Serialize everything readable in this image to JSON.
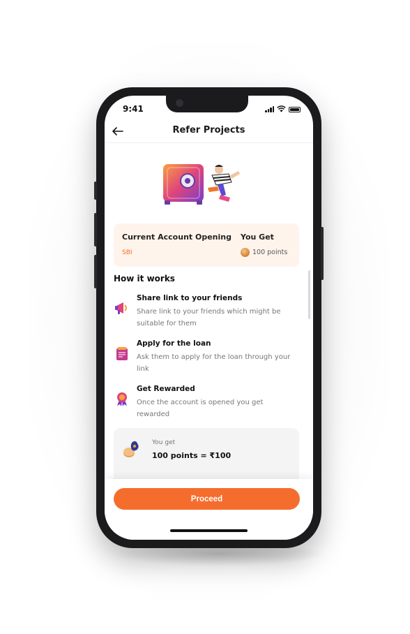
{
  "status_bar": {
    "time": "9:41"
  },
  "header": {
    "title": "Refer Projects",
    "back_icon": "arrow-left-icon"
  },
  "offer": {
    "name": "Current Account Opening",
    "bank": "SBI",
    "get_label": "You Get",
    "points": "100 points"
  },
  "how_it_works": {
    "title": "How it works",
    "steps": [
      {
        "icon": "megaphone-icon",
        "title": "Share link to your friends",
        "description": "Share link to your friends which might be suitable for them"
      },
      {
        "icon": "application-form-icon",
        "title": "Apply for the loan",
        "description": "Ask them to apply for the loan through your link"
      },
      {
        "icon": "reward-badge-icon",
        "title": "Get Rewarded",
        "description": "Once the account is opened you get rewarded"
      }
    ]
  },
  "reward": {
    "label": "You get",
    "value": "100 points = ₹100"
  },
  "footer": {
    "proceed_label": "Proceed"
  },
  "colors": {
    "accent": "#f56d2d",
    "offer_bg": "#fff4ec",
    "bank_text": "#f26b2a"
  }
}
